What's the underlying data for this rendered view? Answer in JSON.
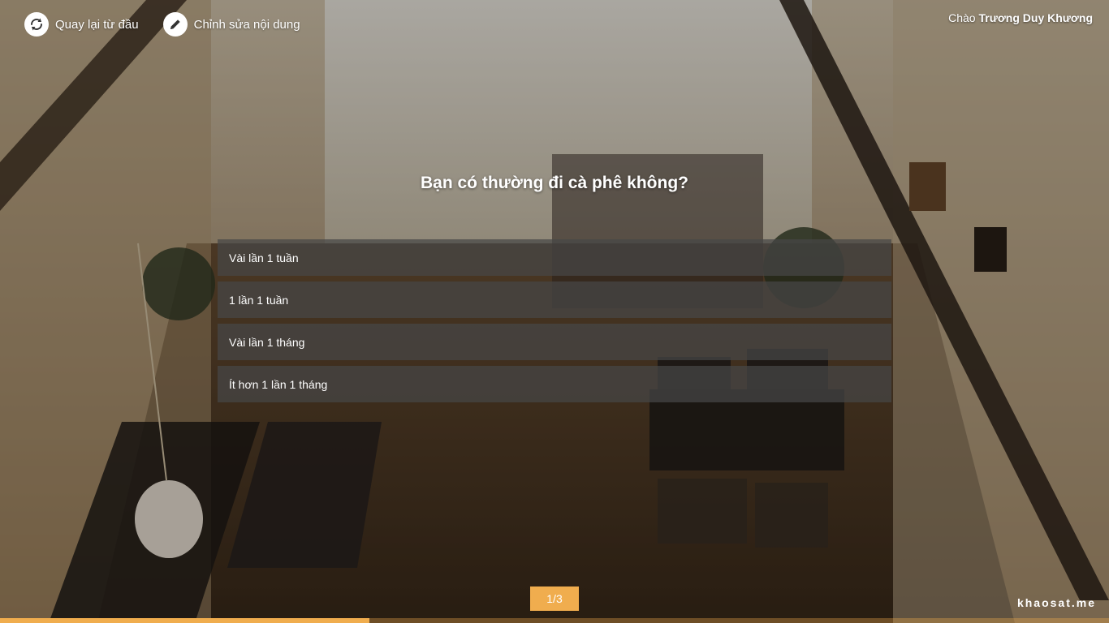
{
  "header": {
    "restart_label": "Quay lại từ đầu",
    "edit_label": "Chỉnh sửa nội dung",
    "restart_icon": "refresh-icon",
    "edit_icon": "pencil-icon",
    "greeting_prefix": "Chào",
    "user_name": "Trương Duy Khương"
  },
  "survey": {
    "question": "Bạn có thường đi cà phê không?",
    "options": [
      "Vài lần 1 tuần",
      "1 lần 1 tuần",
      "Vài lần 1 tháng",
      "Ít hơn 1 lần 1 tháng"
    ],
    "page_indicator": "1/3",
    "progress_fraction": 0.333
  },
  "footer": {
    "brand": "khaosat.me"
  },
  "colors": {
    "accent": "#f0ad4e",
    "option_bg": "#464646"
  }
}
